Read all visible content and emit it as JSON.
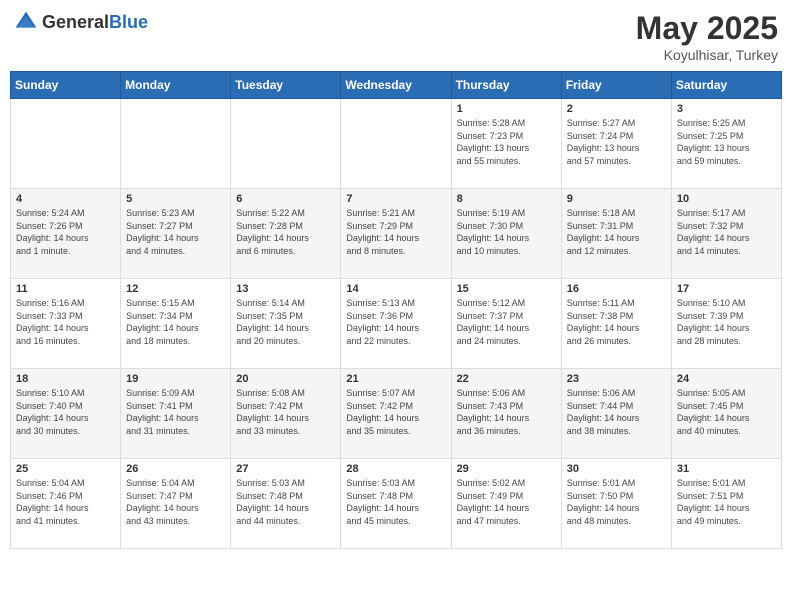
{
  "logo": {
    "text_general": "General",
    "text_blue": "Blue"
  },
  "title": {
    "month_year": "May 2025",
    "location": "Koyulhisar, Turkey"
  },
  "weekdays": [
    "Sunday",
    "Monday",
    "Tuesday",
    "Wednesday",
    "Thursday",
    "Friday",
    "Saturday"
  ],
  "weeks": [
    [
      {
        "day": "",
        "info": ""
      },
      {
        "day": "",
        "info": ""
      },
      {
        "day": "",
        "info": ""
      },
      {
        "day": "",
        "info": ""
      },
      {
        "day": "1",
        "info": "Sunrise: 5:28 AM\nSunset: 7:23 PM\nDaylight: 13 hours\nand 55 minutes."
      },
      {
        "day": "2",
        "info": "Sunrise: 5:27 AM\nSunset: 7:24 PM\nDaylight: 13 hours\nand 57 minutes."
      },
      {
        "day": "3",
        "info": "Sunrise: 5:25 AM\nSunset: 7:25 PM\nDaylight: 13 hours\nand 59 minutes."
      }
    ],
    [
      {
        "day": "4",
        "info": "Sunrise: 5:24 AM\nSunset: 7:26 PM\nDaylight: 14 hours\nand 1 minute."
      },
      {
        "day": "5",
        "info": "Sunrise: 5:23 AM\nSunset: 7:27 PM\nDaylight: 14 hours\nand 4 minutes."
      },
      {
        "day": "6",
        "info": "Sunrise: 5:22 AM\nSunset: 7:28 PM\nDaylight: 14 hours\nand 6 minutes."
      },
      {
        "day": "7",
        "info": "Sunrise: 5:21 AM\nSunset: 7:29 PM\nDaylight: 14 hours\nand 8 minutes."
      },
      {
        "day": "8",
        "info": "Sunrise: 5:19 AM\nSunset: 7:30 PM\nDaylight: 14 hours\nand 10 minutes."
      },
      {
        "day": "9",
        "info": "Sunrise: 5:18 AM\nSunset: 7:31 PM\nDaylight: 14 hours\nand 12 minutes."
      },
      {
        "day": "10",
        "info": "Sunrise: 5:17 AM\nSunset: 7:32 PM\nDaylight: 14 hours\nand 14 minutes."
      }
    ],
    [
      {
        "day": "11",
        "info": "Sunrise: 5:16 AM\nSunset: 7:33 PM\nDaylight: 14 hours\nand 16 minutes."
      },
      {
        "day": "12",
        "info": "Sunrise: 5:15 AM\nSunset: 7:34 PM\nDaylight: 14 hours\nand 18 minutes."
      },
      {
        "day": "13",
        "info": "Sunrise: 5:14 AM\nSunset: 7:35 PM\nDaylight: 14 hours\nand 20 minutes."
      },
      {
        "day": "14",
        "info": "Sunrise: 5:13 AM\nSunset: 7:36 PM\nDaylight: 14 hours\nand 22 minutes."
      },
      {
        "day": "15",
        "info": "Sunrise: 5:12 AM\nSunset: 7:37 PM\nDaylight: 14 hours\nand 24 minutes."
      },
      {
        "day": "16",
        "info": "Sunrise: 5:11 AM\nSunset: 7:38 PM\nDaylight: 14 hours\nand 26 minutes."
      },
      {
        "day": "17",
        "info": "Sunrise: 5:10 AM\nSunset: 7:39 PM\nDaylight: 14 hours\nand 28 minutes."
      }
    ],
    [
      {
        "day": "18",
        "info": "Sunrise: 5:10 AM\nSunset: 7:40 PM\nDaylight: 14 hours\nand 30 minutes."
      },
      {
        "day": "19",
        "info": "Sunrise: 5:09 AM\nSunset: 7:41 PM\nDaylight: 14 hours\nand 31 minutes."
      },
      {
        "day": "20",
        "info": "Sunrise: 5:08 AM\nSunset: 7:42 PM\nDaylight: 14 hours\nand 33 minutes."
      },
      {
        "day": "21",
        "info": "Sunrise: 5:07 AM\nSunset: 7:42 PM\nDaylight: 14 hours\nand 35 minutes."
      },
      {
        "day": "22",
        "info": "Sunrise: 5:06 AM\nSunset: 7:43 PM\nDaylight: 14 hours\nand 36 minutes."
      },
      {
        "day": "23",
        "info": "Sunrise: 5:06 AM\nSunset: 7:44 PM\nDaylight: 14 hours\nand 38 minutes."
      },
      {
        "day": "24",
        "info": "Sunrise: 5:05 AM\nSunset: 7:45 PM\nDaylight: 14 hours\nand 40 minutes."
      }
    ],
    [
      {
        "day": "25",
        "info": "Sunrise: 5:04 AM\nSunset: 7:46 PM\nDaylight: 14 hours\nand 41 minutes."
      },
      {
        "day": "26",
        "info": "Sunrise: 5:04 AM\nSunset: 7:47 PM\nDaylight: 14 hours\nand 43 minutes."
      },
      {
        "day": "27",
        "info": "Sunrise: 5:03 AM\nSunset: 7:48 PM\nDaylight: 14 hours\nand 44 minutes."
      },
      {
        "day": "28",
        "info": "Sunrise: 5:03 AM\nSunset: 7:48 PM\nDaylight: 14 hours\nand 45 minutes."
      },
      {
        "day": "29",
        "info": "Sunrise: 5:02 AM\nSunset: 7:49 PM\nDaylight: 14 hours\nand 47 minutes."
      },
      {
        "day": "30",
        "info": "Sunrise: 5:01 AM\nSunset: 7:50 PM\nDaylight: 14 hours\nand 48 minutes."
      },
      {
        "day": "31",
        "info": "Sunrise: 5:01 AM\nSunset: 7:51 PM\nDaylight: 14 hours\nand 49 minutes."
      }
    ]
  ]
}
